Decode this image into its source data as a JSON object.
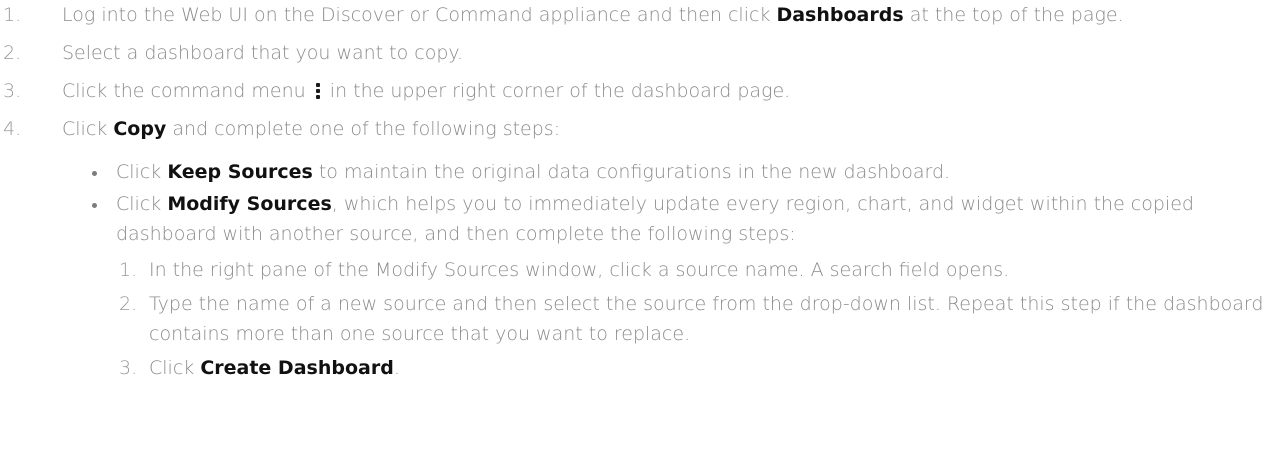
{
  "steps": [
    {
      "number": "1.",
      "pre": "Log into the Web UI on the Discover or Command appliance and then click ",
      "bold": "Dashboards",
      "post": " at the top of the page."
    },
    {
      "number": "2.",
      "text": "Select a dashboard that you want to copy."
    },
    {
      "number": "3.",
      "pre": "Click the command menu",
      "icon": "command-menu-icon",
      "post": "in the upper right corner of the dashboard page."
    },
    {
      "number": "4.",
      "pre": "Click ",
      "bold": "Copy",
      "post": " and complete one of the following steps:",
      "options": [
        {
          "pre": "Click ",
          "bold": "Keep Sources",
          "post": " to maintain the original data configurations in the new dashboard."
        },
        {
          "pre": "Click ",
          "bold": "Modify Sources",
          "post": ", which helps you to immediately update every region, chart, and widget within the copied dashboard with another source, and then complete the following steps:",
          "substeps": [
            {
              "number": "1.",
              "text": "In the right pane of the Modify Sources window, click a source name. A search field opens."
            },
            {
              "number": "2.",
              "text": "Type the name of a new source and then select the source from the drop-down list. Repeat this step if the dashboard contains more than one source that you want to replace."
            },
            {
              "number": "3.",
              "pre": "Click ",
              "bold": "Create Dashboard",
              "post": "."
            }
          ]
        }
      ]
    }
  ]
}
